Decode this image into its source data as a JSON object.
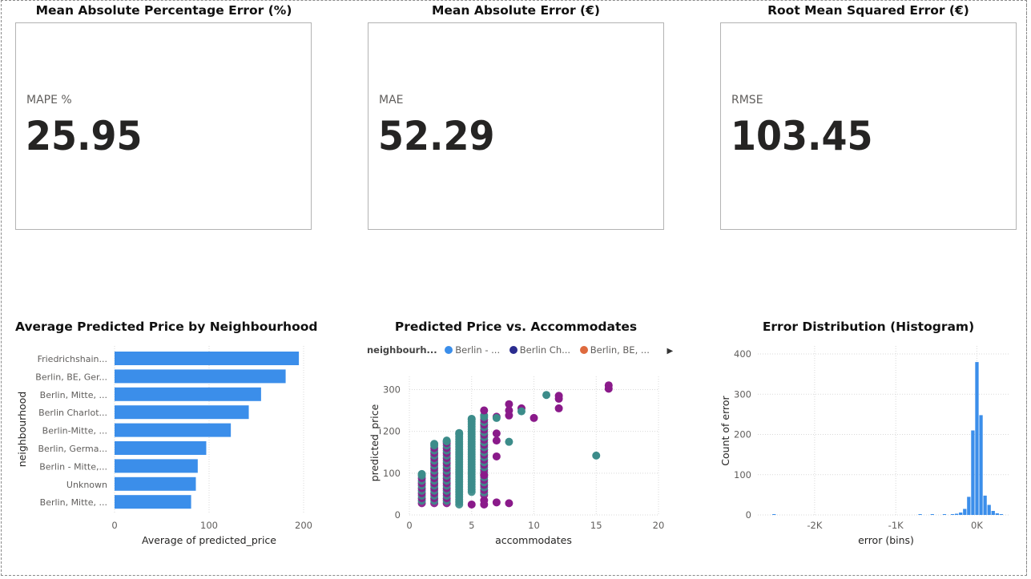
{
  "cards": [
    {
      "title": "Mean Absolute Percentage Error (%)",
      "label": "MAPE %",
      "value": "25.95"
    },
    {
      "title": "Mean Absolute Error (€)",
      "label": "MAE",
      "value": "52.29"
    },
    {
      "title": "Root Mean Squared Error (€)",
      "label": "RMSE",
      "value": "103.45"
    }
  ],
  "colors": {
    "bar": "#3b8eea",
    "series_a": "#3b8eea",
    "series_b": "#2b2c8f",
    "series_c": "#de6a3e",
    "series_purple": "#8a1a8a",
    "series_teal": "#3c8c8a",
    "gridline": "#d9d9d9"
  },
  "chart_data": [
    {
      "type": "bar",
      "orientation": "horizontal",
      "title": "Average Predicted Price by Neighbourhood",
      "xlabel": "Average of predicted_price",
      "ylabel": "neighbourhood",
      "categories": [
        "Friedrichshain...",
        "Berlin, BE, Ger...",
        "Berlin, Mitte, ...",
        "Berlin Charlot...",
        "Berlin-Mitte, ...",
        "Berlin, Germa...",
        "Berlin - Mitte,...",
        "Unknown",
        "Berlin, Mitte, ..."
      ],
      "values": [
        195,
        181,
        155,
        142,
        123,
        97,
        88,
        86,
        81
      ],
      "xlim": [
        0,
        200
      ],
      "xticks": [
        0,
        100,
        200
      ],
      "grid": true
    },
    {
      "type": "scatter",
      "title": "Predicted Price vs. Accommodates",
      "xlabel": "accommodates",
      "ylabel": "predicted_price",
      "xlim": [
        0,
        20
      ],
      "ylim": [
        0,
        320
      ],
      "xticks": [
        0,
        5,
        10,
        15,
        20
      ],
      "yticks": [
        0,
        100,
        200,
        300
      ],
      "legend": {
        "title": "neighbourh...",
        "entries": [
          {
            "name": "Berlin - ...",
            "color": "#3b8eea"
          },
          {
            "name": "Berlin Ch...",
            "color": "#2b2c8f"
          },
          {
            "name": "Berlin, BE, ...",
            "color": "#de6a3e"
          }
        ],
        "placement": "top"
      },
      "column_ranges": [
        {
          "x": 1,
          "y_min": 28,
          "y_max": 98
        },
        {
          "x": 2,
          "y_min": 28,
          "y_max": 170
        },
        {
          "x": 3,
          "y_min": 28,
          "y_max": 176
        },
        {
          "x": 4,
          "y_min": 25,
          "y_max": 196
        },
        {
          "x": 5,
          "y_min": 55,
          "y_max": 228
        },
        {
          "x": 6,
          "y_min": 48,
          "y_max": 238
        }
      ],
      "points": [
        {
          "x": 3,
          "y": 178,
          "color": "teal"
        },
        {
          "x": 5,
          "y": 230,
          "color": "teal"
        },
        {
          "x": 5,
          "y": 25,
          "color": "purple"
        },
        {
          "x": 6,
          "y": 35,
          "color": "purple"
        },
        {
          "x": 6,
          "y": 25,
          "color": "purple"
        },
        {
          "x": 6,
          "y": 95,
          "color": "purple"
        },
        {
          "x": 6,
          "y": 250,
          "color": "purple"
        },
        {
          "x": 7,
          "y": 235,
          "color": "purple"
        },
        {
          "x": 7,
          "y": 195,
          "color": "purple"
        },
        {
          "x": 7,
          "y": 178,
          "color": "purple"
        },
        {
          "x": 7,
          "y": 140,
          "color": "purple"
        },
        {
          "x": 7,
          "y": 30,
          "color": "purple"
        },
        {
          "x": 7,
          "y": 232,
          "color": "teal"
        },
        {
          "x": 8,
          "y": 265,
          "color": "purple"
        },
        {
          "x": 8,
          "y": 250,
          "color": "purple"
        },
        {
          "x": 8,
          "y": 238,
          "color": "purple"
        },
        {
          "x": 8,
          "y": 28,
          "color": "purple"
        },
        {
          "x": 8,
          "y": 175,
          "color": "teal"
        },
        {
          "x": 9,
          "y": 255,
          "color": "purple"
        },
        {
          "x": 9,
          "y": 248,
          "color": "teal"
        },
        {
          "x": 10,
          "y": 232,
          "color": "purple"
        },
        {
          "x": 11,
          "y": 287,
          "color": "teal"
        },
        {
          "x": 12,
          "y": 285,
          "color": "purple"
        },
        {
          "x": 12,
          "y": 278,
          "color": "purple"
        },
        {
          "x": 12,
          "y": 255,
          "color": "purple"
        },
        {
          "x": 15,
          "y": 142,
          "color": "teal"
        },
        {
          "x": 16,
          "y": 310,
          "color": "purple"
        },
        {
          "x": 16,
          "y": 302,
          "color": "purple"
        }
      ]
    },
    {
      "type": "bar",
      "subtype": "histogram",
      "title": "Error Distribution (Histogram)",
      "xlabel": "error (bins)",
      "ylabel": "Count of error",
      "ylim": [
        0,
        420
      ],
      "yticks": [
        0,
        100,
        200,
        300,
        400
      ],
      "xticks": [
        -2000,
        -1000,
        0
      ],
      "xtick_labels": [
        "-2K",
        "-1K",
        "0K"
      ],
      "bin_width": 50,
      "bins": [
        {
          "x": -2500,
          "count": 1
        },
        {
          "x": -700,
          "count": 1
        },
        {
          "x": -550,
          "count": 1
        },
        {
          "x": -400,
          "count": 1
        },
        {
          "x": -300,
          "count": 2
        },
        {
          "x": -250,
          "count": 3
        },
        {
          "x": -200,
          "count": 6
        },
        {
          "x": -150,
          "count": 15
        },
        {
          "x": -100,
          "count": 45
        },
        {
          "x": -50,
          "count": 210
        },
        {
          "x": 0,
          "count": 380
        },
        {
          "x": 50,
          "count": 248
        },
        {
          "x": 100,
          "count": 48
        },
        {
          "x": 150,
          "count": 25
        },
        {
          "x": 200,
          "count": 10
        },
        {
          "x": 250,
          "count": 4
        },
        {
          "x": 300,
          "count": 2
        }
      ]
    }
  ]
}
